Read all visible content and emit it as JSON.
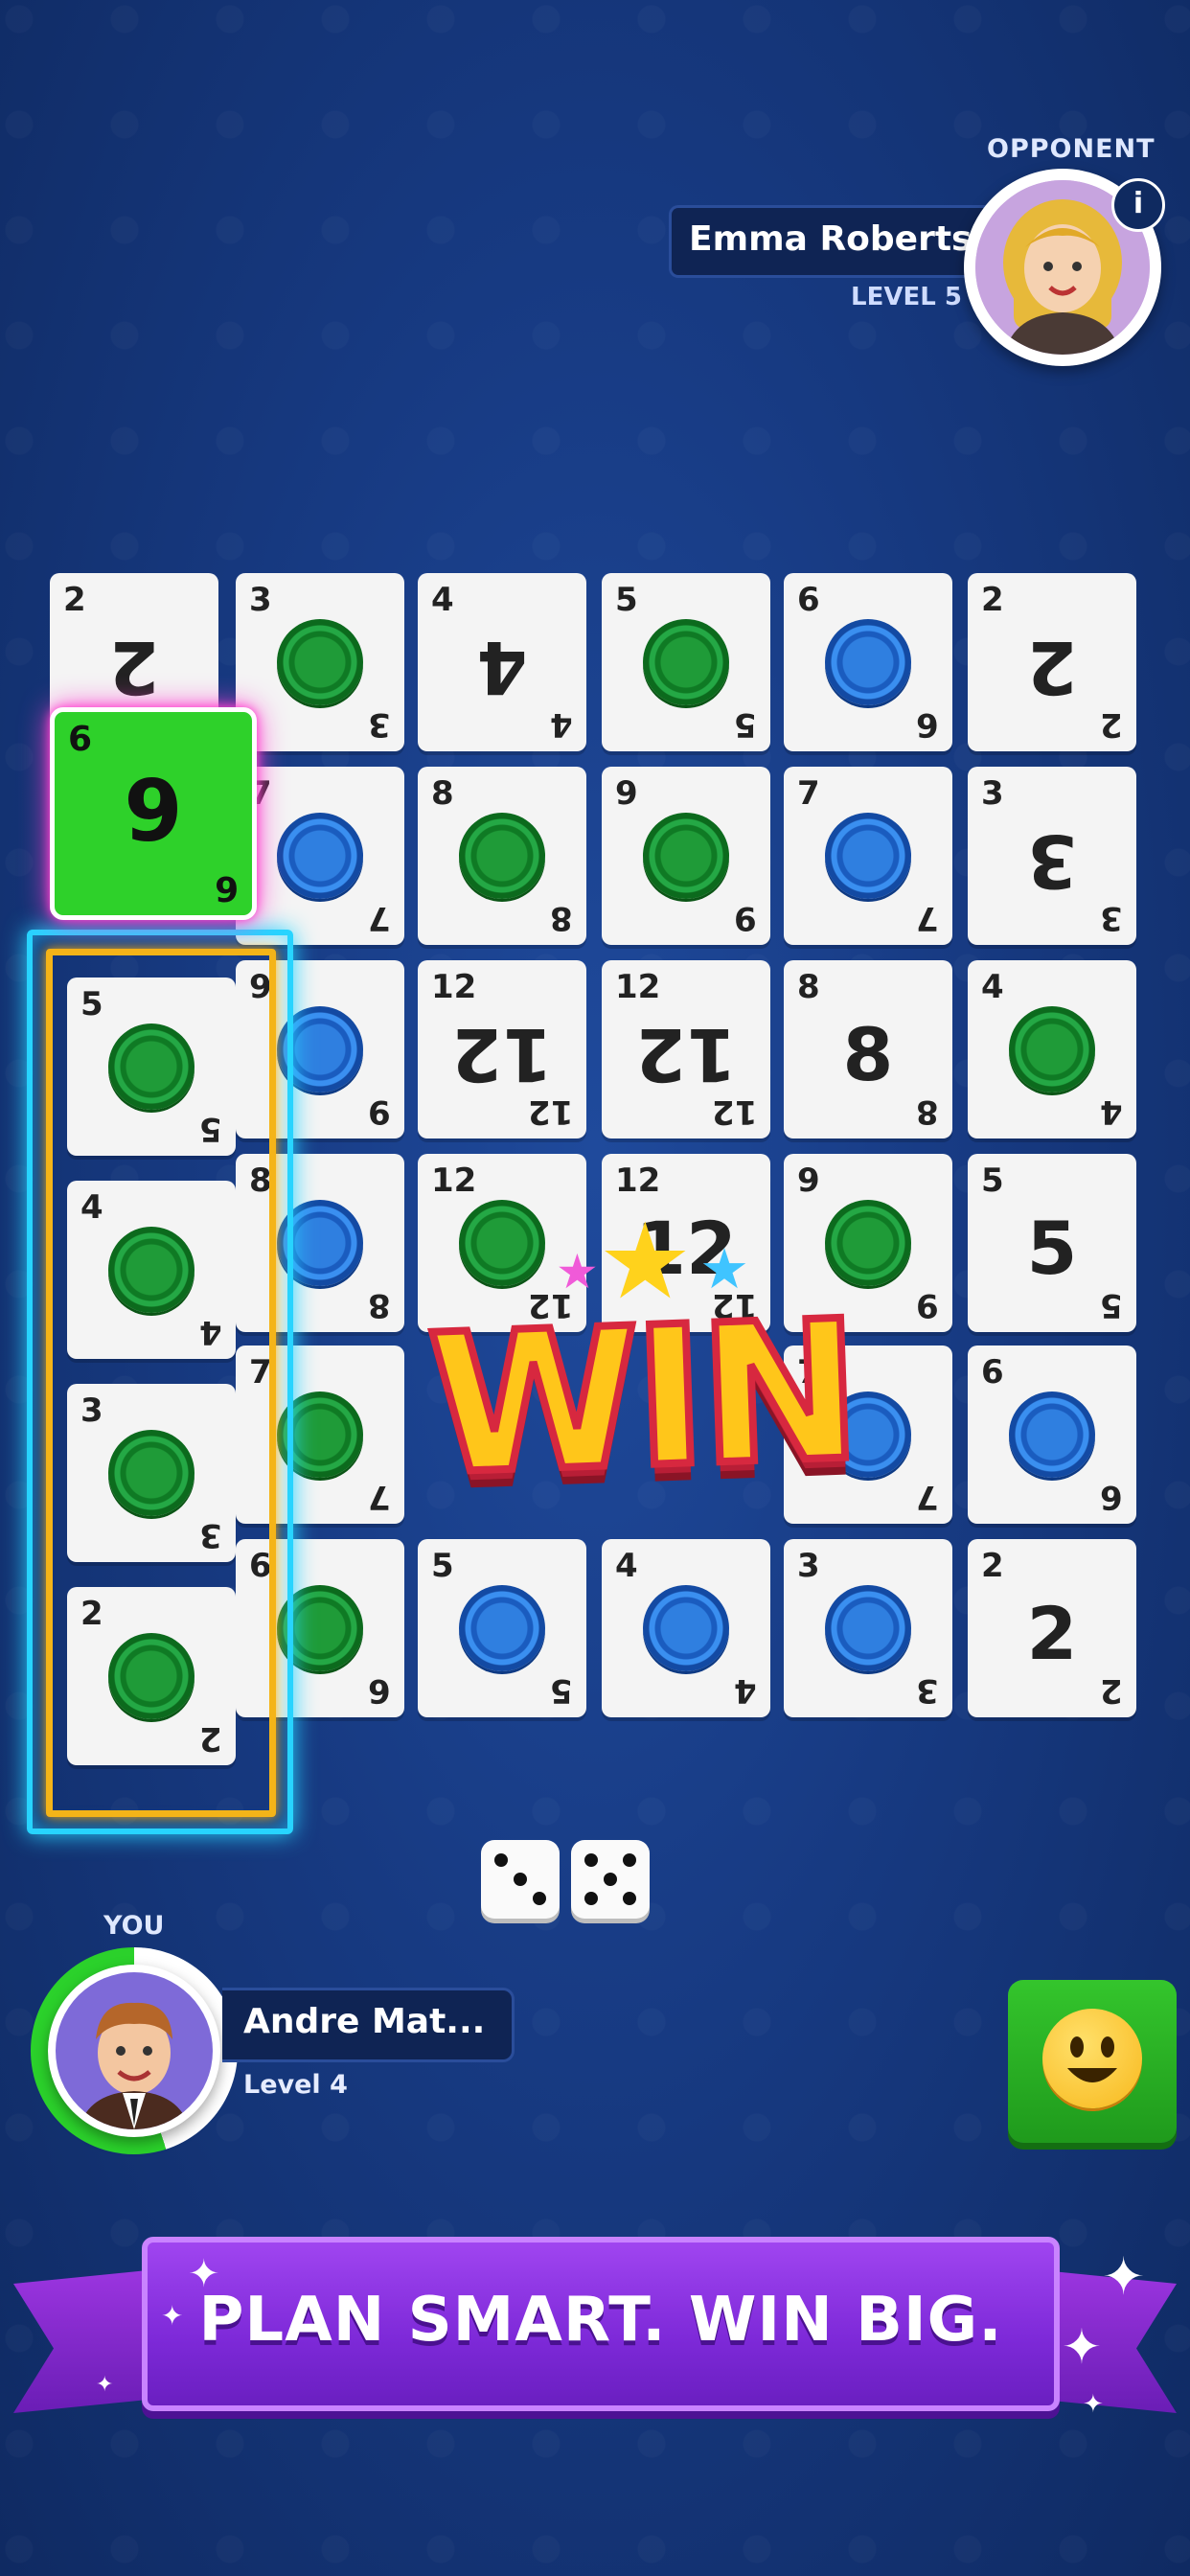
{
  "opponent": {
    "label": "OPPONENT",
    "name": "Emma Roberts",
    "level": "LEVEL 5",
    "info_icon": "i"
  },
  "player": {
    "label": "YOU",
    "name": "Andre Mat...",
    "level": "Level 4",
    "timer_progress_percent": 55
  },
  "board": {
    "rows": [
      [
        {
          "v": "2",
          "t": "num",
          "flip": true
        },
        {
          "v": "3",
          "t": "green"
        },
        {
          "v": "4",
          "t": "num",
          "flip": true
        },
        {
          "v": "5",
          "t": "green"
        },
        {
          "v": "6",
          "t": "blue"
        },
        {
          "v": "2",
          "t": "num",
          "flip": true
        }
      ],
      [
        {
          "v": "7",
          "t": "blue"
        },
        {
          "v": "8",
          "t": "green"
        },
        {
          "v": "9",
          "t": "green"
        },
        {
          "v": "7",
          "t": "blue"
        },
        {
          "v": "3",
          "t": "num",
          "flip": true
        }
      ],
      [
        {
          "v": "9",
          "t": "blue"
        },
        {
          "v": "12",
          "t": "num",
          "flip": true
        },
        {
          "v": "12",
          "t": "num",
          "flip": true
        },
        {
          "v": "8",
          "t": "num"
        },
        {
          "v": "4",
          "t": "green"
        }
      ],
      [
        {
          "v": "8",
          "t": "blue"
        },
        {
          "v": "12",
          "t": "green"
        },
        {
          "v": "12",
          "t": "num"
        },
        {
          "v": "9",
          "t": "green"
        },
        {
          "v": "5",
          "t": "num"
        }
      ],
      [
        {
          "v": "7",
          "t": "green"
        },
        {
          "v": "",
          "t": "empty"
        },
        {
          "v": "",
          "t": "empty"
        },
        {
          "v": "7",
          "t": "blue"
        },
        {
          "v": "6",
          "t": "blue"
        }
      ],
      [
        {
          "v": "6",
          "t": "green"
        },
        {
          "v": "5",
          "t": "blue"
        },
        {
          "v": "4",
          "t": "blue"
        },
        {
          "v": "3",
          "t": "blue"
        },
        {
          "v": "2",
          "t": "num"
        }
      ]
    ]
  },
  "active_card": {
    "value": "6",
    "center": "9"
  },
  "hand": [
    {
      "v": "5",
      "t": "green"
    },
    {
      "v": "4",
      "t": "green"
    },
    {
      "v": "3",
      "t": "green"
    },
    {
      "v": "2",
      "t": "green"
    }
  ],
  "win_text": "WIN",
  "dice": [
    3,
    5
  ],
  "banner": {
    "text": "PLAN SMART. WIN BIG."
  },
  "colors": {
    "chip_green": "#1f9b38",
    "chip_blue": "#2f7fe0",
    "active_card": "#2ed12a",
    "win": "#ffc61a",
    "banner": "#8a35e0"
  }
}
